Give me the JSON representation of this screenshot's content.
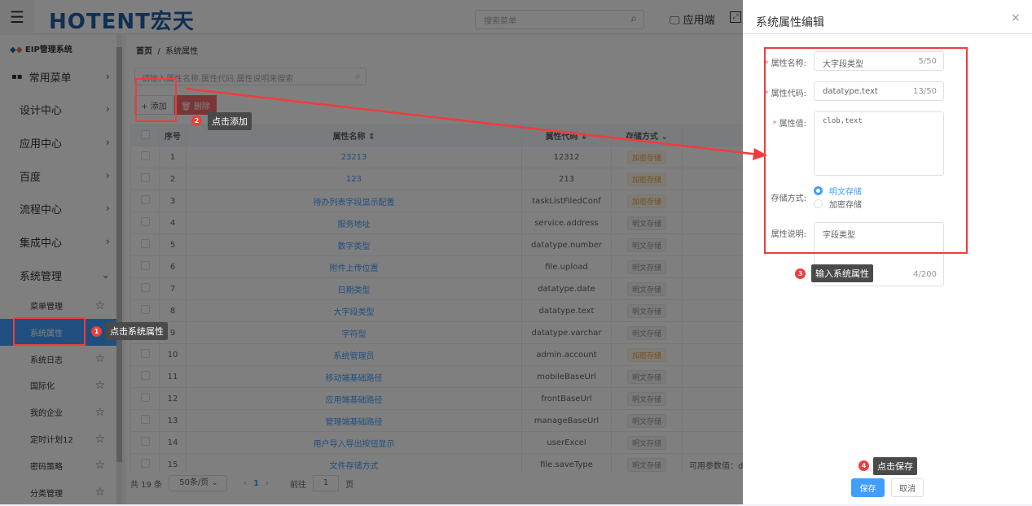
{
  "header": {
    "logo": "HOTENT宏天",
    "menu_search_placeholder": "搜索菜单",
    "app_end": "应用端"
  },
  "sidebar": {
    "title": "EIP管理系统",
    "items": [
      {
        "label": "常用菜单"
      },
      {
        "label": "设计中心"
      },
      {
        "label": "应用中心"
      },
      {
        "label": "百度"
      },
      {
        "label": "流程中心"
      },
      {
        "label": "集成中心"
      },
      {
        "label": "系统管理"
      }
    ],
    "sub_items": [
      {
        "label": "菜单管理"
      },
      {
        "label": "系统属性"
      },
      {
        "label": "系统日志"
      },
      {
        "label": "国际化"
      },
      {
        "label": "我的企业"
      },
      {
        "label": "定时计划12"
      },
      {
        "label": "密码策略"
      },
      {
        "label": "分类管理"
      }
    ]
  },
  "breadcrumb": {
    "home": "首页",
    "current": "系统属性"
  },
  "toolbar": {
    "search_placeholder": "请输入属性名称,属性代码,属性说明来搜索",
    "add": "+ 添加",
    "delete": "🗑 删除"
  },
  "table": {
    "headers": [
      "序号",
      "属性名称 ⇕",
      "属性代码 ⇕",
      "存储方式 ⌄",
      ""
    ],
    "rows": [
      {
        "no": "1",
        "name": "23213",
        "code": "12312",
        "storage": "加密存储",
        "enc": true,
        "desc": ""
      },
      {
        "no": "2",
        "name": "123",
        "code": "213",
        "storage": "加密存储",
        "enc": true,
        "desc": ""
      },
      {
        "no": "3",
        "name": "待办列表字段显示配置",
        "code": "taskListFiledConf",
        "storage": "加密存储",
        "enc": true,
        "desc": ""
      },
      {
        "no": "4",
        "name": "服务地址",
        "code": "service.address",
        "storage": "明文存储",
        "enc": false,
        "desc": ""
      },
      {
        "no": "5",
        "name": "数字类型",
        "code": "datatype.number",
        "storage": "明文存储",
        "enc": false,
        "desc": ""
      },
      {
        "no": "6",
        "name": "附件上传位置",
        "code": "file.upload",
        "storage": "明文存储",
        "enc": false,
        "desc": ""
      },
      {
        "no": "7",
        "name": "日期类型",
        "code": "datatype.date",
        "storage": "明文存储",
        "enc": false,
        "desc": ""
      },
      {
        "no": "8",
        "name": "大字段类型",
        "code": "datatype.text",
        "storage": "明文存储",
        "enc": false,
        "desc": ""
      },
      {
        "no": "9",
        "name": "字符型",
        "code": "datatype.varchar",
        "storage": "明文存储",
        "enc": false,
        "desc": ""
      },
      {
        "no": "10",
        "name": "系统管理员",
        "code": "admin.account",
        "storage": "加密存储",
        "enc": true,
        "desc": ""
      },
      {
        "no": "11",
        "name": "移动端基础路径",
        "code": "mobileBaseUrl",
        "storage": "明文存储",
        "enc": false,
        "desc": ""
      },
      {
        "no": "12",
        "name": "应用端基础路径",
        "code": "frontBaseUrl",
        "storage": "明文存储",
        "enc": false,
        "desc": ""
      },
      {
        "no": "13",
        "name": "管理端基础路径",
        "code": "manageBaseUrl",
        "storage": "明文存储",
        "enc": false,
        "desc": ""
      },
      {
        "no": "14",
        "name": "用户导入导出按钮显示",
        "code": "userExcel",
        "storage": "明文存储",
        "enc": false,
        "desc": ""
      },
      {
        "no": "15",
        "name": "文件存储方式",
        "code": "file.saveType",
        "storage": "明文存储",
        "enc": false,
        "desc": "可用参数值：dat"
      }
    ]
  },
  "pager": {
    "total": "共 19 条",
    "page_size": "50条/页 ⌄",
    "prev": "‹",
    "page": "1",
    "next": "›",
    "goto": "前往",
    "goto_value": "1",
    "page_unit": "页"
  },
  "drawer": {
    "title": "系统属性编辑",
    "close": "×",
    "name_label": "属性名称:",
    "name_value": "大字段类型",
    "name_count": "5/50",
    "code_label": "属性代码:",
    "code_value": "datatype.text",
    "code_count": "13/50",
    "value_label": "属性值:",
    "value_value": "clob,text",
    "storage_label": "存储方式:",
    "storage_options": [
      "明文存储",
      "加密存储"
    ],
    "storage_selected": "明文存储",
    "desc_label": "属性说明:",
    "desc_value": "字段类型",
    "desc_count": "4/200",
    "save": "保存",
    "cancel": "取消"
  },
  "annotations": [
    {
      "n": "1",
      "text": "点击系统属性"
    },
    {
      "n": "2",
      "text": "点击添加"
    },
    {
      "n": "3",
      "text": "输入系统属性"
    },
    {
      "n": "4",
      "text": "点击保存"
    }
  ],
  "colors": {
    "primary": "#409eff",
    "annotation": "#f03c3c",
    "danger": "#f56c6c"
  }
}
